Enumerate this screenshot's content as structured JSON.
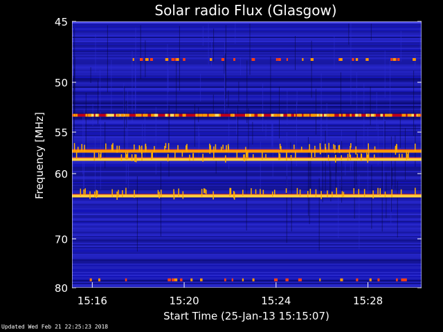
{
  "chart_data": {
    "type": "heatmap",
    "title": "Solar radio Flux (Glasgow)",
    "xlabel": "Start Time (25-Jan-13 15:15:07)",
    "ylabel": "Frequency [MHz]",
    "x_start": "15:15:07",
    "x_end": "15:30:20",
    "xticks": [
      "15:16",
      "15:20",
      "15:24",
      "15:28"
    ],
    "ylim": [
      45,
      80
    ],
    "yticks": [
      45,
      50,
      55,
      60,
      70,
      80
    ],
    "ytick_labels": [
      "45",
      "50",
      "55",
      "60",
      "70",
      "80"
    ],
    "colors": {
      "background": "#1a1aa8",
      "low": "#0a0a6e",
      "high": "#ff9a00",
      "peak": "#ffd040"
    },
    "bands": [
      {
        "freq": 53.2,
        "intensity": "high",
        "pattern": "intermittent"
      },
      {
        "freq": 57.2,
        "intensity": "high",
        "pattern": "continuous"
      },
      {
        "freq": 58.2,
        "intensity": "peak",
        "pattern": "continuous"
      },
      {
        "freq": 63.1,
        "intensity": "peak",
        "pattern": "continuous"
      },
      {
        "freq": 48.0,
        "intensity": "high",
        "pattern": "sparse"
      },
      {
        "freq": 78.2,
        "intensity": "high",
        "pattern": "sparse"
      }
    ]
  },
  "footer": {
    "updated": "Updated Wed Feb 21 22:25:23 2018"
  }
}
